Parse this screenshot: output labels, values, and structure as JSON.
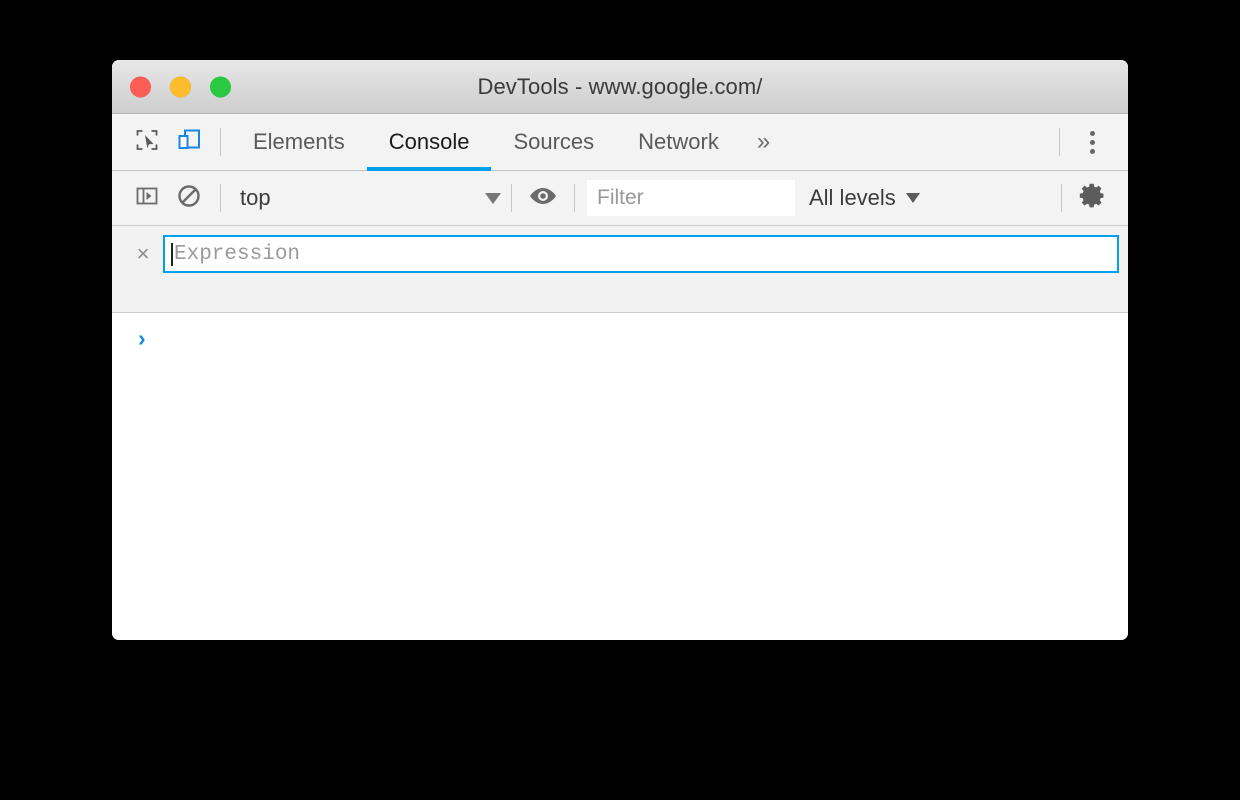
{
  "window": {
    "title": "DevTools - www.google.com/",
    "traffic_lights": [
      {
        "name": "close",
        "color": "#fc5d55"
      },
      {
        "name": "minimize",
        "color": "#fdbc2c"
      },
      {
        "name": "zoom",
        "color": "#2bc941"
      }
    ]
  },
  "tabbar": {
    "inspect_icon": "inspect-element-icon",
    "device_icon": "device-toolbar-icon",
    "device_icon_color": "#1a87e5",
    "tabs": [
      {
        "label": "Elements",
        "active": false
      },
      {
        "label": "Console",
        "active": true
      },
      {
        "label": "Sources",
        "active": false
      },
      {
        "label": "Network",
        "active": false
      }
    ],
    "overflow_label": "»",
    "active_underline_color": "#00a0f0",
    "menu_icon": "kebab-menu-icon"
  },
  "console_toolbar": {
    "sidebar_toggle_icon": "console-sidebar-toggle-icon",
    "clear_console_icon": "clear-console-icon",
    "context": {
      "value": "top",
      "caret": "▼"
    },
    "eye_icon": "live-expression-eye-icon",
    "filter": {
      "value": "",
      "placeholder": "Filter"
    },
    "levels": {
      "label": "All levels",
      "caret": "▼"
    },
    "settings_icon": "settings-gear-icon"
  },
  "live_expression": {
    "close_label": "×",
    "value": "",
    "placeholder": "Expression",
    "focus_color": "#00a0f0"
  },
  "console_body": {
    "prompt_symbol": "›",
    "prompt_color": "#1a87e5"
  }
}
